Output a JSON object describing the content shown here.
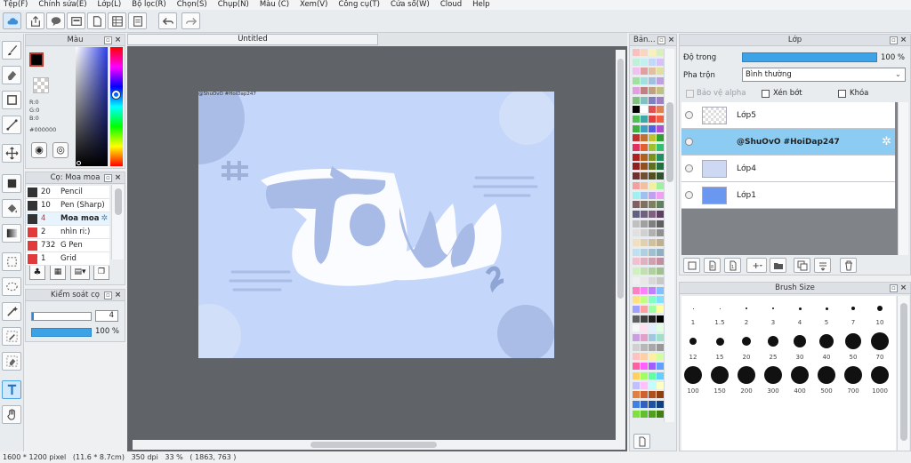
{
  "menu": [
    "Tệp(F)",
    "Chỉnh sửa(E)",
    "Lớp(L)",
    "Bộ lọc(R)",
    "Chọn(S)",
    "Chụp(N)",
    "Màu (C)",
    "Xem(V)",
    "Công cụ(T)",
    "Cửa sổ(W)",
    "Cloud",
    "Help"
  ],
  "color_panel": {
    "title": "Màu",
    "r": "R:0",
    "g": "G:0",
    "b": "B:0",
    "hex": "#000000"
  },
  "brush_panel": {
    "title": "Cọ: Moa moa",
    "items": [
      {
        "size": "20",
        "name": "Pencil",
        "color": "#333333"
      },
      {
        "size": "10",
        "name": "Pen (Sharp)",
        "color": "#333333"
      },
      {
        "size": "4",
        "name": "Moa moa",
        "color": "#333333"
      },
      {
        "size": "2",
        "name": "nhìn ri:)",
        "color": "#e23a3a"
      },
      {
        "size": "732",
        "name": "G Pen",
        "color": "#e23a3a"
      },
      {
        "size": "1",
        "name": "Grid",
        "color": "#e23a3a"
      }
    ]
  },
  "control_panel": {
    "title": "Kiểm soát cọ",
    "size_value": "4",
    "opacity_value": "100 %"
  },
  "document": {
    "tab": "Untitled",
    "watermark": "@ShuOvO #HoiDap247"
  },
  "swatch_panel": {
    "title": "Bản..."
  },
  "layer_panel": {
    "title": "Lớp",
    "opacity_label": "Độ trong",
    "opacity_value": "100 %",
    "blend_label": "Pha trộn",
    "blend_value": "Bình thường",
    "protect_alpha": "Bảo vệ alpha",
    "clipping": "Xén bớt",
    "lock": "Khóa",
    "layers": [
      {
        "name": "Lớp5",
        "selected": false
      },
      {
        "name": "@ShuOvO #HoiDap247",
        "selected": true
      },
      {
        "name": "Lớp4",
        "selected": false
      },
      {
        "name": "Lớp1",
        "selected": false
      }
    ]
  },
  "brushsize_panel": {
    "title": "Brush Size",
    "sizes": [
      "1",
      "1.5",
      "2",
      "3",
      "4",
      "5",
      "7",
      "10",
      "12",
      "15",
      "20",
      "25",
      "30",
      "40",
      "50",
      "70",
      "100",
      "150",
      "200",
      "300",
      "400",
      "500",
      "700",
      "1000"
    ]
  },
  "status": "1600 * 1200 pixel   (11.6 * 8.7cm)   350 dpi   33 %   ( 1863, 763 )"
}
